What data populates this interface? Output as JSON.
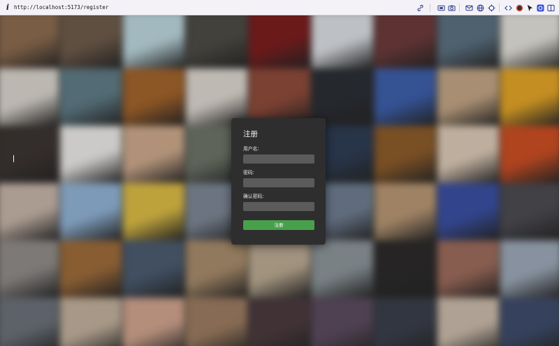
{
  "browser": {
    "url": "http://localhost:5173/register",
    "toolbar_icons": [
      "link-icon",
      "screen-icon",
      "camera-icon",
      "mail-icon",
      "globe-icon",
      "target-icon",
      "code-icon",
      "record-icon",
      "cursor-icon",
      "extension-icon",
      "sidebar-icon"
    ]
  },
  "register_form": {
    "title": "注册",
    "username_label": "用户名:",
    "username_value": "",
    "password_label": "密码:",
    "password_value": "",
    "confirm_label": "确认密码:",
    "confirm_value": "",
    "submit_label": "注册"
  },
  "colors": {
    "modal_bg": "#2e2e2e",
    "input_bg": "#5b5b5b",
    "submit_bg": "#49a04b"
  },
  "background_posters": [
    "#8a6a4e",
    "#6d5a4a",
    "#b9d3da",
    "#4c4a44",
    "#7a1e1e",
    "#d8dbe0",
    "#6b3a3a",
    "#5a6e7e",
    "#e0ddd6",
    "#d6d1ca",
    "#5f7a84",
    "#a0622b",
    "#d9d3cc",
    "#8c4a3a",
    "#2b2e34",
    "#3d5ea8",
    "#c0a383",
    "#e0a227",
    "#3b3431",
    "#e8e6e4",
    "#caa78a",
    "#6b7266",
    "#3a3a42",
    "#2e3c52",
    "#8a5a2a",
    "#d9c7b4",
    "#c84e24",
    "#c3b2a6",
    "#8fb0d2",
    "#d8b945",
    "#7b8593",
    "#3c3e44",
    "#6e7c8f",
    "#b59572",
    "#3a4fa0",
    "#4a4a50",
    "#8e8a88",
    "#9b6a3a",
    "#4a5a6e",
    "#a68a6a",
    "#b8a890",
    "#8a9398",
    "#2c2a2a",
    "#9a6a5a",
    "#9aa6b5",
    "#6a6f78",
    "#bfae9a",
    "#cda18c",
    "#9a7a60",
    "#4a3a3e",
    "#5a4a5e",
    "#3a3e4a",
    "#c8b8a8",
    "#3e4c6a"
  ]
}
